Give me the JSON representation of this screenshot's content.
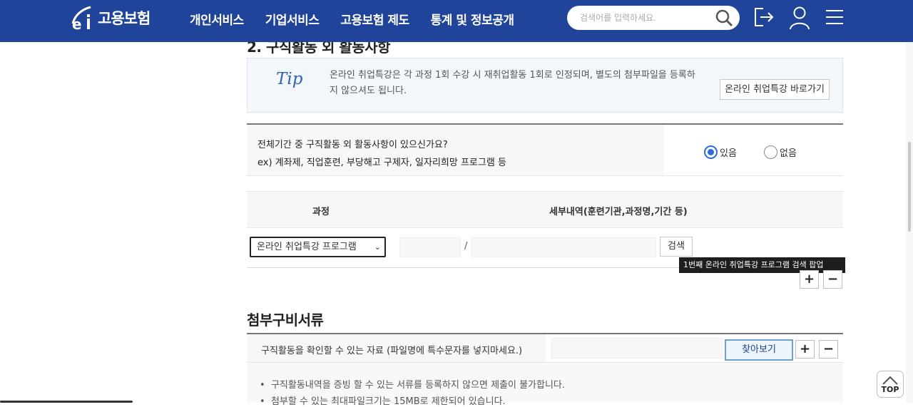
{
  "header": {
    "logo_text": "고용보험",
    "nav": [
      "개인서비스",
      "기업서비스",
      "고용보험 제도",
      "통계 및 정보공개"
    ],
    "search_placeholder": "검색어를 입력하세요."
  },
  "section1": {
    "title": "2. 구직활동 외 활동사항",
    "tip": {
      "icon_text": "Tip",
      "text": "온라인 취업특강은 각 과정 1회 수강 시 재취업활동 1회로 인정되며, 별도의 첨부파일을 등록하지 않으셔도 됩니다.",
      "button": "온라인 취업특강 바로가기"
    },
    "question": {
      "line1": "전체기간 중 구직활동 외 활동사항이 있으신가요?",
      "line2": "ex) 계좌제, 직업훈련, 부당해고 구제자, 일자리희망 프로그램 등",
      "options": [
        {
          "label": "있음",
          "selected": true
        },
        {
          "label": "없음",
          "selected": false
        }
      ]
    },
    "table": {
      "headers": [
        "과정",
        "세부내역(훈련기관,과정명,기간 등)"
      ],
      "row": {
        "course": "온라인 취업특강 프로그램",
        "separator": "/",
        "search_button": "검색",
        "tooltip": "1번째 온라인 취업특강 프로그램 검색 팝업"
      },
      "add_label": "+",
      "remove_label": "−"
    }
  },
  "section2": {
    "title": "첨부구비서류",
    "label": "구직활동을 확인할 수 있는 자료 (파일명에 특수문자를 넣지마세요.)",
    "find_button": "찾아보기",
    "add_label": "+",
    "remove_label": "−",
    "notes": [
      "구직활동내역을 증빙 할 수 있는 서류를 등록하지 않으면 제출이 불가합니다.",
      "첨부할 수 있는 최대파일크기는 15MB로 제한되어 있습니다."
    ]
  },
  "top_button": "TOP",
  "colors": {
    "header_bg": "#20449a",
    "radio_on": "#2d6bd6",
    "tip_bg": "#f2f7fc"
  }
}
